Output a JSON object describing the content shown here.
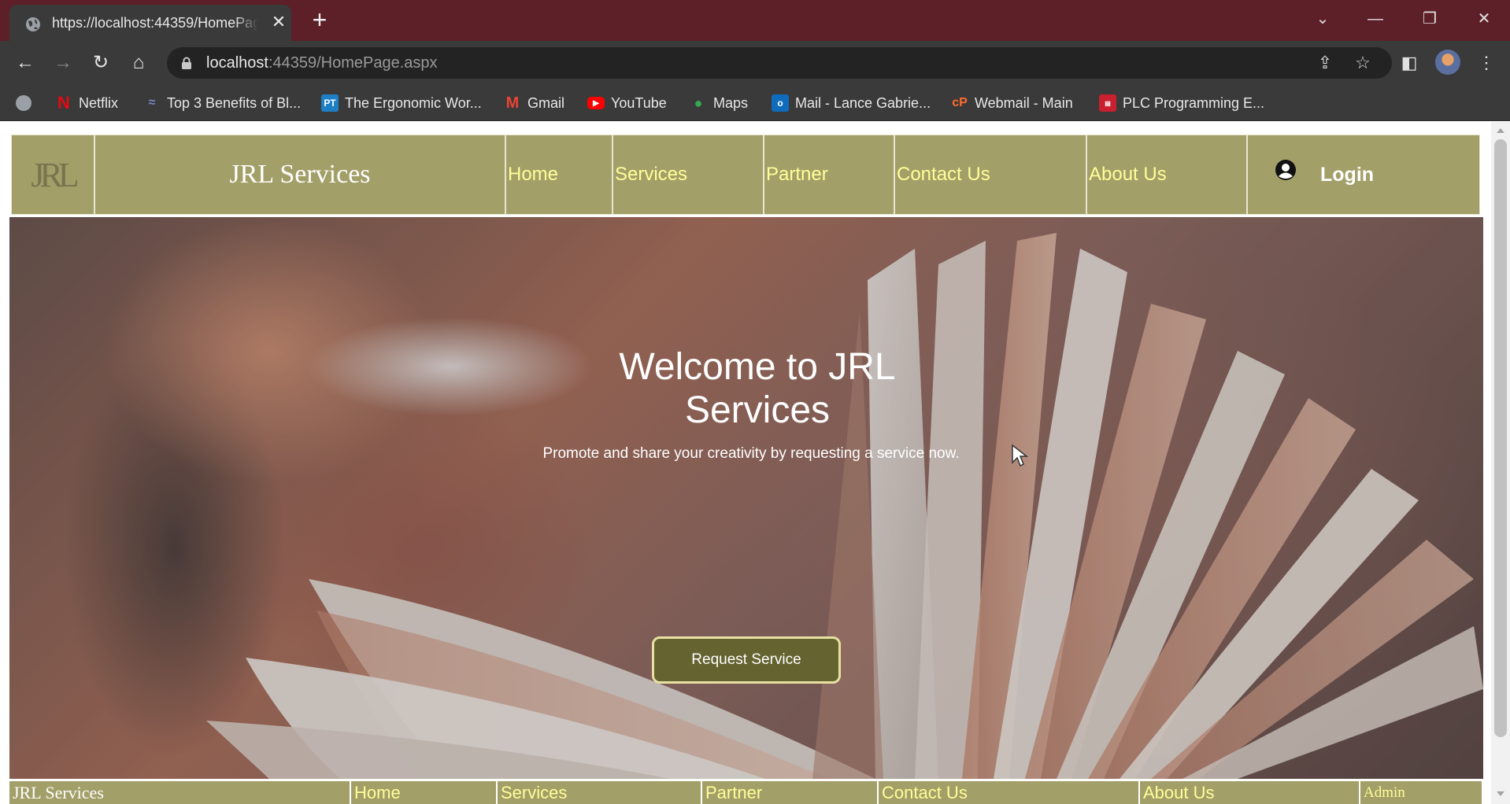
{
  "browser": {
    "tab_title": "https://localhost:44359/HomePage.aspx",
    "url_host": "localhost",
    "url_path": ":44359/HomePage.aspx",
    "bookmarks": [
      {
        "label": "Netflix",
        "icon": "netflix-icon"
      },
      {
        "label": "Top 3 Benefits of Bl...",
        "icon": "blog-icon"
      },
      {
        "label": "The Ergonomic Wor...",
        "icon": "pt-icon"
      },
      {
        "label": "Gmail",
        "icon": "gmail-icon"
      },
      {
        "label": "YouTube",
        "icon": "youtube-icon"
      },
      {
        "label": "Maps",
        "icon": "maps-icon"
      },
      {
        "label": "Mail - Lance Gabrie...",
        "icon": "outlook-icon"
      },
      {
        "label": "Webmail - Main",
        "icon": "cpanel-icon"
      },
      {
        "label": "PLC Programming E...",
        "icon": "plc-icon"
      }
    ]
  },
  "header": {
    "logo_text": "JRL",
    "brand": "JRL Services",
    "nav": [
      "Home",
      "Services",
      "Partner",
      "Contact Us",
      "About Us"
    ],
    "login_label": "Login"
  },
  "hero": {
    "title": "Welcome to JRL Services",
    "subtitle": "Promote and share your creativity by requesting a service now.",
    "button_label": "Request Service"
  },
  "footer": {
    "brand": "JRL Services",
    "nav": [
      "Home",
      "Services",
      "Partner",
      "Contact Us",
      "About Us"
    ],
    "admin": "Admin"
  },
  "colors": {
    "header_bg": "#a39f68",
    "nav_text": "#ffff99",
    "button_bg": "#65632f",
    "tabbar_bg": "#5d1f28"
  }
}
